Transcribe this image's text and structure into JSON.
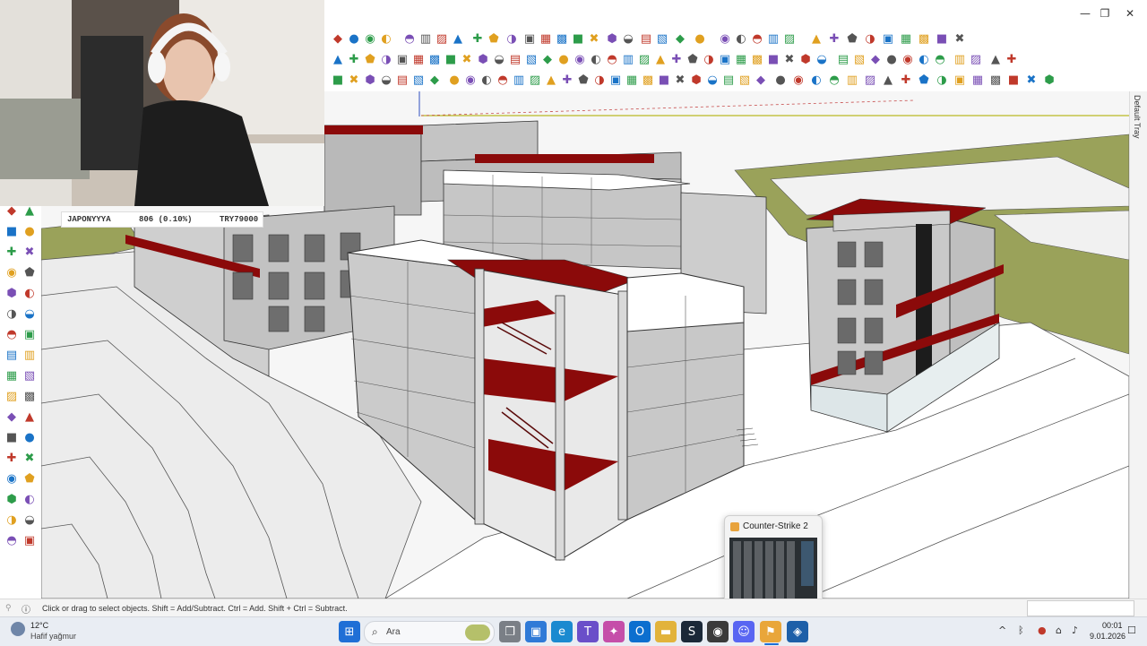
{
  "window": {
    "minimize_icon": "minimize-icon",
    "maximize_icon": "restore-icon",
    "close_icon": "close-icon"
  },
  "tray_label": "Default Tray",
  "status_text": "Click or drag to select objects. Shift = Add/Subtract. Ctrl = Add. Shift + Ctrl = Subtract.",
  "overlay": {
    "name": "JAPONYYYA",
    "value": "806 (0.10%)",
    "amount": "TRY79000"
  },
  "preview": {
    "title": "Counter-Strike 2"
  },
  "weather": {
    "temp": "12°C",
    "desc": "Hafif yağmur"
  },
  "search": {
    "label": "Ara"
  },
  "clock": {
    "time": "00:01",
    "date": "9.01.2026"
  },
  "colors": {
    "accent_red": "#8b0a0a",
    "ground": "#9aa25a",
    "taskbar": "#e9edf3"
  }
}
